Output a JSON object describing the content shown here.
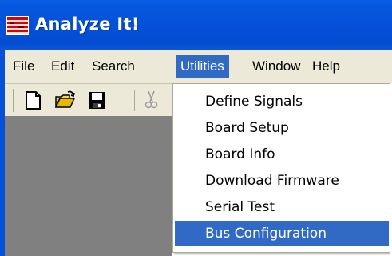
{
  "window": {
    "title": "Analyze It!"
  },
  "menubar": {
    "items": [
      {
        "label": "File",
        "active": false
      },
      {
        "label": "Edit",
        "active": false
      },
      {
        "label": "Search",
        "active": false
      },
      {
        "label": "Utilities",
        "active": true
      },
      {
        "label": "Window",
        "active": false
      },
      {
        "label": "Help",
        "active": false
      }
    ]
  },
  "toolbar": {
    "buttons": [
      {
        "icon": "new-document-icon"
      },
      {
        "icon": "open-folder-icon"
      },
      {
        "icon": "save-icon"
      },
      {
        "icon": "cut-icon",
        "disabled": true
      }
    ]
  },
  "utilities_menu": {
    "items": [
      {
        "label": "Define Signals"
      },
      {
        "label": "Board Setup"
      },
      {
        "label": "Board Info"
      },
      {
        "label": "Download Firmware"
      },
      {
        "label": "Serial Test"
      },
      {
        "label": "Bus Configuration",
        "highlighted": true
      }
    ]
  },
  "colors": {
    "titlebar": "#0451d8",
    "menu_highlight": "#316ac5",
    "menubar_bg": "#ece9d8",
    "client_bg": "#808080"
  }
}
